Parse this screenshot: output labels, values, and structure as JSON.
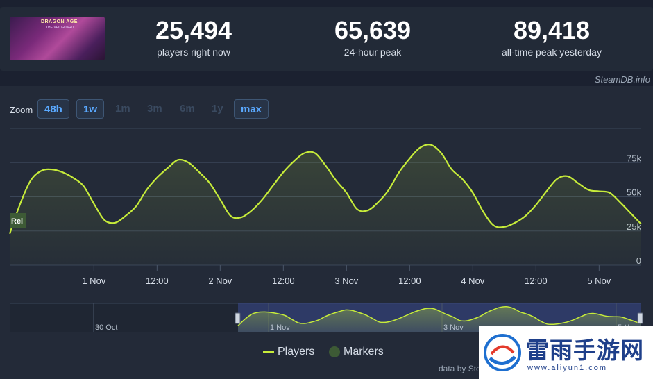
{
  "header": {
    "game_art": {
      "title_line1": "DRAGON AGE",
      "title_line2": "THE VEILGUARD"
    },
    "stats": [
      {
        "value": "25,494",
        "label": "players right now"
      },
      {
        "value": "65,639",
        "label": "24-hour peak"
      },
      {
        "value": "89,418",
        "label": "all-time peak yesterday"
      }
    ],
    "credit": "SteamDB.info"
  },
  "zoom": {
    "label": "Zoom",
    "options": [
      {
        "label": "48h",
        "active": true
      },
      {
        "label": "1w",
        "active": true
      },
      {
        "label": "1m",
        "active": false
      },
      {
        "label": "3m",
        "active": false
      },
      {
        "label": "6m",
        "active": false
      },
      {
        "label": "1y",
        "active": false
      },
      {
        "label": "max",
        "active": true
      }
    ]
  },
  "chart_data": {
    "type": "line",
    "series": [
      {
        "name": "Players",
        "color": "#c7ec3a",
        "x": [
          "Oct 31 08:00",
          "Oct 31 10:00",
          "Oct 31 12:00",
          "Oct 31 14:00",
          "Oct 31 16:00",
          "Oct 31 18:00",
          "Oct 31 20:00",
          "Oct 31 22:00",
          "Nov 1 00:00",
          "Nov 1 02:00",
          "Nov 1 04:00",
          "Nov 1 06:00",
          "Nov 1 08:00",
          "Nov 1 10:00",
          "Nov 1 12:00",
          "Nov 1 14:00",
          "Nov 1 16:00",
          "Nov 1 18:00",
          "Nov 1 20:00",
          "Nov 1 22:00",
          "Nov 2 00:00",
          "Nov 2 02:00",
          "Nov 2 04:00",
          "Nov 2 06:00",
          "Nov 2 08:00",
          "Nov 2 10:00",
          "Nov 2 12:00",
          "Nov 2 14:00",
          "Nov 2 16:00",
          "Nov 2 18:00",
          "Nov 2 20:00",
          "Nov 2 22:00",
          "Nov 3 00:00",
          "Nov 3 02:00",
          "Nov 3 04:00",
          "Nov 3 06:00",
          "Nov 3 08:00",
          "Nov 3 10:00",
          "Nov 3 12:00",
          "Nov 3 14:00",
          "Nov 3 16:00",
          "Nov 3 18:00",
          "Nov 3 20:00",
          "Nov 3 22:00",
          "Nov 4 00:00",
          "Nov 4 02:00",
          "Nov 4 04:00",
          "Nov 4 06:00",
          "Nov 4 08:00",
          "Nov 4 10:00",
          "Nov 4 12:00",
          "Nov 4 14:00",
          "Nov 4 16:00",
          "Nov 4 18:00",
          "Nov 4 20:00",
          "Nov 4 22:00",
          "Nov 5 00:00",
          "Nov 5 02:00",
          "Nov 5 04:00",
          "Nov 5 06:00",
          "Nov 5 07:00"
        ],
        "values": [
          23000,
          45000,
          62000,
          69000,
          70000,
          68000,
          64000,
          58000,
          45000,
          33000,
          31000,
          36000,
          43000,
          55000,
          64000,
          71000,
          77000,
          75000,
          68000,
          60000,
          48000,
          36000,
          35000,
          40000,
          48000,
          58000,
          68000,
          76000,
          82000,
          82000,
          73000,
          62000,
          53000,
          41000,
          40000,
          46000,
          55000,
          68000,
          78000,
          86000,
          88000,
          82000,
          70000,
          63000,
          53000,
          39000,
          29000,
          28000,
          31000,
          36000,
          44000,
          54000,
          63000,
          65000,
          60000,
          55000,
          54000,
          53000,
          46000,
          38000,
          30000
        ]
      }
    ],
    "yticks": [
      "0",
      "25k",
      "50k",
      "75k"
    ],
    "ylim": [
      0,
      100000
    ],
    "xticks": [
      "1 Nov",
      "12:00",
      "2 Nov",
      "12:00",
      "3 Nov",
      "12:00",
      "4 Nov",
      "12:00",
      "5 Nov"
    ],
    "marker": {
      "label": "Rel"
    },
    "navigator": {
      "labels": [
        "30 Oct",
        "1 Nov",
        "3 Nov",
        "5 Nov"
      ]
    },
    "legend": [
      {
        "name": "Players",
        "color": "#c7ec3a"
      },
      {
        "name": "Markers",
        "color": "#3d5a35"
      }
    ],
    "grid": true
  },
  "footer": {
    "credit": "data by Ste"
  },
  "watermark": {
    "title": "雷雨手游网",
    "url": "www.aliyun1.com"
  }
}
